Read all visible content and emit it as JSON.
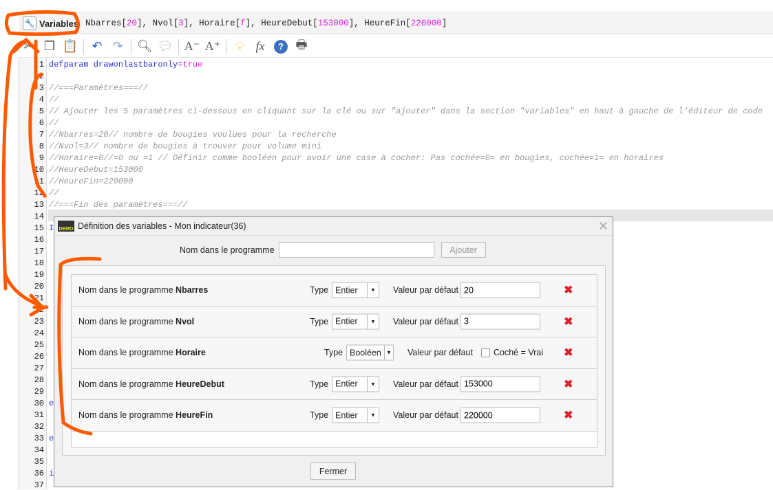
{
  "header": {
    "variables_button": "Variables",
    "variables": [
      {
        "name": "Nbarres",
        "value": "20",
        "sep": ", "
      },
      {
        "name": "Nvol",
        "value": "3",
        "sep": ", "
      },
      {
        "name": "Horaire",
        "value": "f",
        "sep": ", "
      },
      {
        "name": "HeureDebut",
        "value": "153000",
        "sep": ", "
      },
      {
        "name": "HeureFin",
        "value": "220000",
        "sep": ""
      }
    ]
  },
  "toolbar": [
    "cut-icon",
    "copy-icon",
    "paste-icon",
    "undo-icon",
    "redo-icon",
    "search-icon",
    "comment-icon",
    "decrease-font-icon",
    "increase-font-icon",
    "lightbulb-icon",
    "function-icon",
    "help-icon",
    "print-icon"
  ],
  "editor": {
    "line_numbers": [
      "1",
      "2",
      "3",
      "4",
      "5",
      "6",
      "7",
      "8",
      "9",
      "10",
      "11",
      "12",
      "13",
      "14",
      "15",
      "16",
      "17",
      "18",
      "19",
      "20",
      "21",
      "22",
      "23",
      "24",
      "25",
      "26",
      "27",
      "28",
      "29",
      "30",
      "31",
      "32",
      "33",
      "34",
      "35",
      "36",
      "37"
    ],
    "line1": {
      "kw": "defparam drawonlastbaronly=",
      "val": "true"
    },
    "comments": {
      "3": "//===Paramètres===//",
      "4": "//",
      "5": "// Ajouter les 5 paramètres ci-dessous en cliquant sur la clé ou sur \"ajouter\" dans la section \"variables\" en haut à gauche de l'éditeur de code",
      "6": "//",
      "7": "//Nbarres=20// nombre de bougies voulues pour la recherche",
      "8": "//Nvol=3// nombre de bougies à trouver pour volume mini",
      "9": "//Horaire=0//=0 ou =1 // Définir comme booléen pour avoir une case à cocher: Pas cochée=0= en bougies, cochée=1= en horaires",
      "10": "//HeureDebut=153000",
      "11": "//HeureFin=220000",
      "12": "//",
      "13": "//===Fin des paramètres===//"
    },
    "fragments": {
      "15": "I",
      "30": "e",
      "33": "e",
      "36": "i"
    }
  },
  "dialog": {
    "title": "Définition des variables - Mon indicateur(36)",
    "name_label": "Nom dans le programme",
    "name_value": "",
    "add_button": "Ajouter",
    "close_button": "Fermer",
    "row_label": "Nom dans le programme",
    "type_label": "Type",
    "default_label": "Valeur par défaut",
    "checkbox_label": "Coché = Vrai",
    "rows": [
      {
        "name": "Nbarres",
        "type": "Entier",
        "value": "20"
      },
      {
        "name": "Nvol",
        "type": "Entier",
        "value": "3"
      },
      {
        "name": "Horaire",
        "type": "Booléen",
        "checked": false
      },
      {
        "name": "HeureDebut",
        "type": "Entier",
        "value": "153000"
      },
      {
        "name": "HeureFin",
        "type": "Entier",
        "value": "220000"
      }
    ]
  },
  "colors": {
    "annotation": "#ff5a00",
    "keyword": "#3030d0",
    "value": "#e020e0",
    "delete": "#e0202a"
  }
}
